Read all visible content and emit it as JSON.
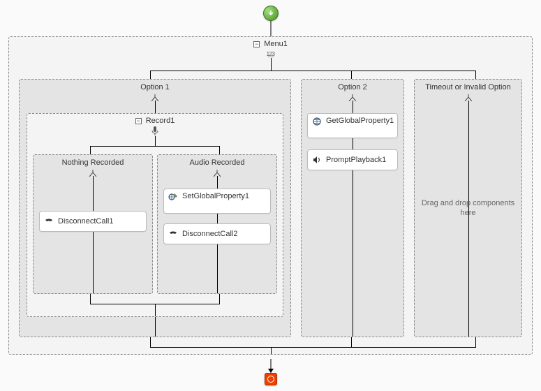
{
  "start": {
    "tooltip": "Start"
  },
  "end": {
    "tooltip": "End"
  },
  "menu": {
    "title": "Menu1",
    "collapse_symbol": "−",
    "icon_text": "1̲2̲3",
    "options": [
      {
        "title": "Option 1",
        "record": {
          "title": "Record1",
          "collapse_symbol": "−",
          "branches": [
            {
              "title": "Nothing Recorded",
              "components": [
                {
                  "label": "DisconnectCall1",
                  "icon": "phone"
                }
              ]
            },
            {
              "title": "Audio Recorded",
              "components": [
                {
                  "label": "SetGlobalProperty1",
                  "icon": "globe-pencil"
                },
                {
                  "label": "DisconnectCall2",
                  "icon": "phone"
                }
              ]
            }
          ]
        }
      },
      {
        "title": "Option 2",
        "components": [
          {
            "label": "GetGlobalProperty1",
            "icon": "globe"
          },
          {
            "label": "PromptPlayback1",
            "icon": "speaker"
          }
        ]
      },
      {
        "title": "Timeout or Invalid Option",
        "hint": "Drag and drop components here"
      }
    ]
  }
}
